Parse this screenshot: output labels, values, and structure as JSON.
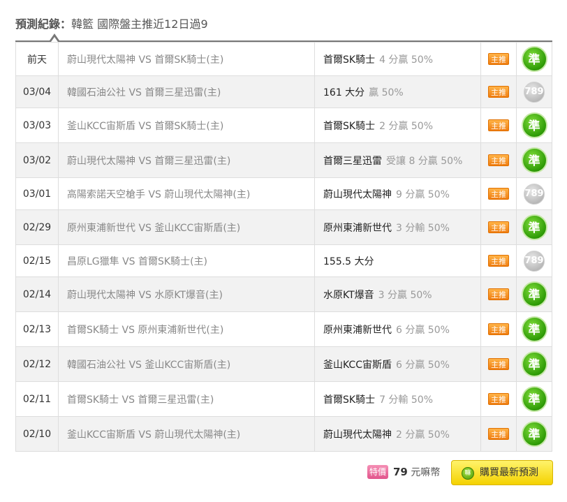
{
  "header": {
    "label": "預測紀錄：",
    "title": "韓籃 國際盤主推近12日過9"
  },
  "records": [
    {
      "date": "前天",
      "match": "蔚山現代太陽神 VS 首爾SK騎士(主)",
      "pick": "首爾SK騎士",
      "detail": "4 分贏 50%",
      "tag": "主推",
      "result": "hit",
      "result_text": "準"
    },
    {
      "date": "03/04",
      "match": "韓國石油公社 VS 首爾三星迅雷(主)",
      "pick": "161 大分",
      "detail": "贏 50%",
      "tag": "主推",
      "result": "push",
      "result_text": "789"
    },
    {
      "date": "03/03",
      "match": "釜山KCC宙斯盾 VS 首爾SK騎士(主)",
      "pick": "首爾SK騎士",
      "detail": "2 分贏 50%",
      "tag": "主推",
      "result": "hit",
      "result_text": "準"
    },
    {
      "date": "03/02",
      "match": "蔚山現代太陽神 VS 首爾三星迅雷(主)",
      "pick": "首爾三星迅雷",
      "detail": "受讓 8 分贏 50%",
      "tag": "主推",
      "result": "hit",
      "result_text": "準"
    },
    {
      "date": "03/01",
      "match": "高陽索諾天空槍手 VS 蔚山現代太陽神(主)",
      "pick": "蔚山現代太陽神",
      "detail": "9 分贏 50%",
      "tag": "主推",
      "result": "push",
      "result_text": "789"
    },
    {
      "date": "02/29",
      "match": "原州東浦新世代 VS 釜山KCC宙斯盾(主)",
      "pick": "原州東浦新世代",
      "detail": "3 分輸 50%",
      "tag": "主推",
      "result": "hit",
      "result_text": "準"
    },
    {
      "date": "02/15",
      "match": "昌原LG獵隼 VS 首爾SK騎士(主)",
      "pick": "155.5 大分",
      "detail": "",
      "tag": "主推",
      "result": "push",
      "result_text": "789"
    },
    {
      "date": "02/14",
      "match": "蔚山現代太陽神 VS 水原KT爆音(主)",
      "pick": "水原KT爆音",
      "detail": "3 分贏 50%",
      "tag": "主推",
      "result": "hit",
      "result_text": "準"
    },
    {
      "date": "02/13",
      "match": "首爾SK騎士 VS 原州東浦新世代(主)",
      "pick": "原州東浦新世代",
      "detail": "6 分贏 50%",
      "tag": "主推",
      "result": "hit",
      "result_text": "準"
    },
    {
      "date": "02/12",
      "match": "韓國石油公社 VS 釜山KCC宙斯盾(主)",
      "pick": "釜山KCC宙斯盾",
      "detail": "6 分贏 50%",
      "tag": "主推",
      "result": "hit",
      "result_text": "準"
    },
    {
      "date": "02/11",
      "match": "首爾SK騎士 VS 首爾三星迅雷(主)",
      "pick": "首爾SK騎士",
      "detail": "7 分輸 50%",
      "tag": "主推",
      "result": "hit",
      "result_text": "準"
    },
    {
      "date": "02/10",
      "match": "釜山KCC宙斯盾 VS 蔚山現代太陽神(主)",
      "pick": "蔚山現代太陽神",
      "detail": "2 分贏 50%",
      "tag": "主推",
      "result": "hit",
      "result_text": "準"
    }
  ],
  "footer": {
    "special_tag": "特價",
    "price_value": "79",
    "price_unit": "元嘛幣",
    "coin_icon_text": "嘛",
    "buy_label": "購買最新預測"
  }
}
